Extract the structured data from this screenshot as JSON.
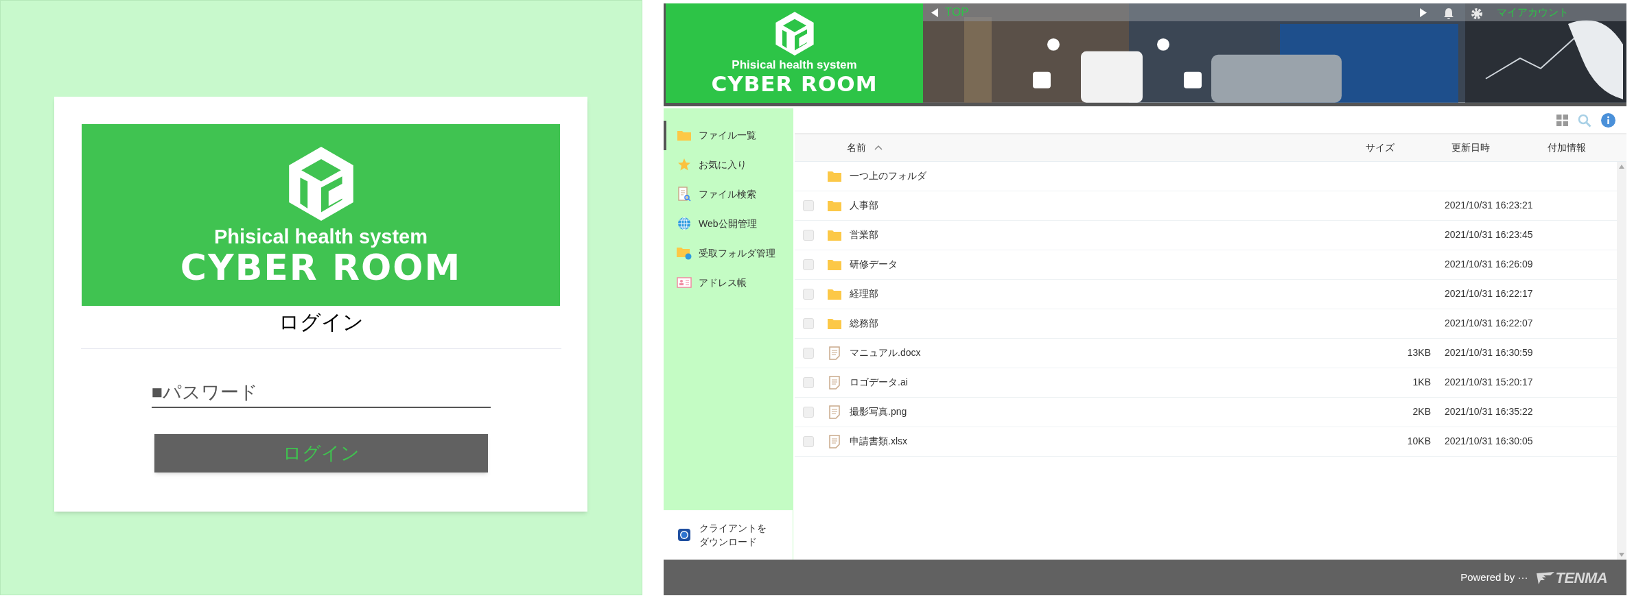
{
  "login": {
    "logo": {
      "tagline": "Phisical health system",
      "name": "CYBER ROOM"
    },
    "title": "ログイン",
    "password": {
      "placeholder": "■パスワード"
    },
    "button": "ログイン"
  },
  "app": {
    "header": {
      "logo": {
        "tagline": "Phisical health system",
        "name": "CYBER ROOM"
      },
      "nav_left": "TOP",
      "nav_right": "マイアカウント"
    },
    "sidebar": {
      "items": [
        {
          "label": "ファイル一覧",
          "selected": true
        },
        {
          "label": "お気に入り",
          "selected": false
        },
        {
          "label": "ファイル検索",
          "selected": false
        },
        {
          "label": "Web公開管理",
          "selected": false
        },
        {
          "label": "受取フォルダ管理",
          "selected": false
        },
        {
          "label": "アドレス帳",
          "selected": false
        }
      ],
      "download": [
        "クライアントを",
        "ダウンロード"
      ]
    },
    "table": {
      "columns": [
        {
          "label": "名前",
          "sort_ascending": true
        },
        {
          "label": "サイズ"
        },
        {
          "label": "更新日時"
        },
        {
          "label": "付加情報"
        }
      ],
      "rows": [
        {
          "kind": "parent",
          "name": "一つ上のフォルダ"
        },
        {
          "kind": "folder",
          "name": "人事部",
          "checked": false,
          "modified": "2021/10/31 16:23:21"
        },
        {
          "kind": "folder",
          "name": "営業部",
          "checked": false,
          "modified": "2021/10/31 16:23:45"
        },
        {
          "kind": "folder",
          "name": "研修データ",
          "checked": false,
          "modified": "2021/10/31 16:26:09"
        },
        {
          "kind": "folder",
          "name": "経理部",
          "checked": false,
          "modified": "2021/10/31 16:22:17"
        },
        {
          "kind": "folder",
          "name": "総務部",
          "checked": false,
          "modified": "2021/10/31 16:22:07"
        },
        {
          "kind": "file",
          "name": "マニュアル.docx",
          "checked": false,
          "size": "13KB",
          "modified": "2021/10/31 16:30:59"
        },
        {
          "kind": "file",
          "name": "ロゴデータ.ai",
          "checked": false,
          "size": "1KB",
          "modified": "2021/10/31 15:20:17"
        },
        {
          "kind": "file",
          "name": "撮影写真.png",
          "checked": false,
          "size": "2KB",
          "modified": "2021/10/31 16:35:22"
        },
        {
          "kind": "file",
          "name": "申請書類.xlsx",
          "checked": false,
          "size": "10KB",
          "modified": "2021/10/31 16:30:05"
        }
      ]
    },
    "footer": {
      "powered": "Powered by ···",
      "brand": "TENMA"
    }
  }
}
